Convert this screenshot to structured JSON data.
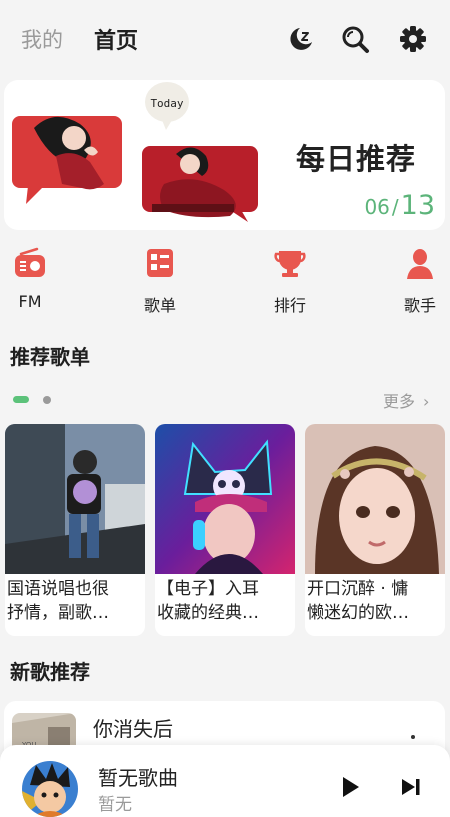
{
  "header": {
    "tab_mine": "我的",
    "tab_home": "首页",
    "icons": [
      "moon-icon",
      "search-icon",
      "gear-icon"
    ]
  },
  "daily": {
    "bubble_text": "Today",
    "title": "每日推荐",
    "month": "06",
    "slash": "/",
    "day": "13",
    "date_color": "#5cb47a"
  },
  "quick_nav": [
    {
      "label": "FM",
      "icon": "radio-icon"
    },
    {
      "label": "歌单",
      "icon": "playlist-icon"
    },
    {
      "label": "排行",
      "icon": "trophy-icon"
    },
    {
      "label": "歌手",
      "icon": "singer-icon"
    }
  ],
  "recommend": {
    "title": "推荐歌单",
    "more": "更多",
    "playlists": [
      {
        "line1": "国语说唱也很",
        "line2": "抒情，副歌…"
      },
      {
        "line1": "【电子】入耳",
        "line2": "收藏的经典…"
      },
      {
        "line1": "开口沉醉 · 慵",
        "line2": "懒迷幻的欧…"
      }
    ]
  },
  "new_songs": {
    "title": "新歌推荐",
    "items": [
      {
        "title": "你消失后",
        "thumb_text": "YOU"
      }
    ]
  },
  "player": {
    "title": "暂无歌曲",
    "subtitle": "暂无"
  },
  "colors": {
    "accent": "#e8574f",
    "green": "#5cc27a"
  }
}
